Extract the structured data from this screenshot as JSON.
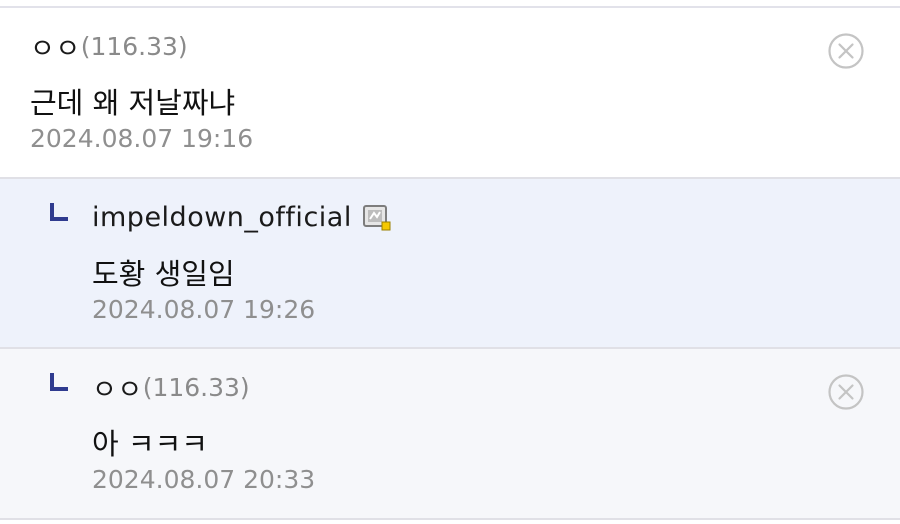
{
  "comments": [
    {
      "nickname": "ㅇㅇ",
      "ip": "(116.33)",
      "text": "근데 왜 저날짜냐",
      "timestamp": "2024.08.07 19:16"
    },
    {
      "nickname": "impeldown_official",
      "text": "도황 생일임",
      "timestamp": "2024.08.07 19:26"
    },
    {
      "nickname": "ㅇㅇ",
      "ip": "(116.33)",
      "text": "아 ㅋㅋㅋ",
      "timestamp": "2024.08.07 20:33"
    }
  ],
  "icons": {
    "delete": "close-circle-icon",
    "reply": "reply-arrow-icon",
    "gallog": "gallog-badge-icon"
  },
  "colors": {
    "reply_background": "#eef2fb",
    "reply_arrow": "#2f3b8f",
    "gallog_badge_dot": "#f5c800"
  }
}
